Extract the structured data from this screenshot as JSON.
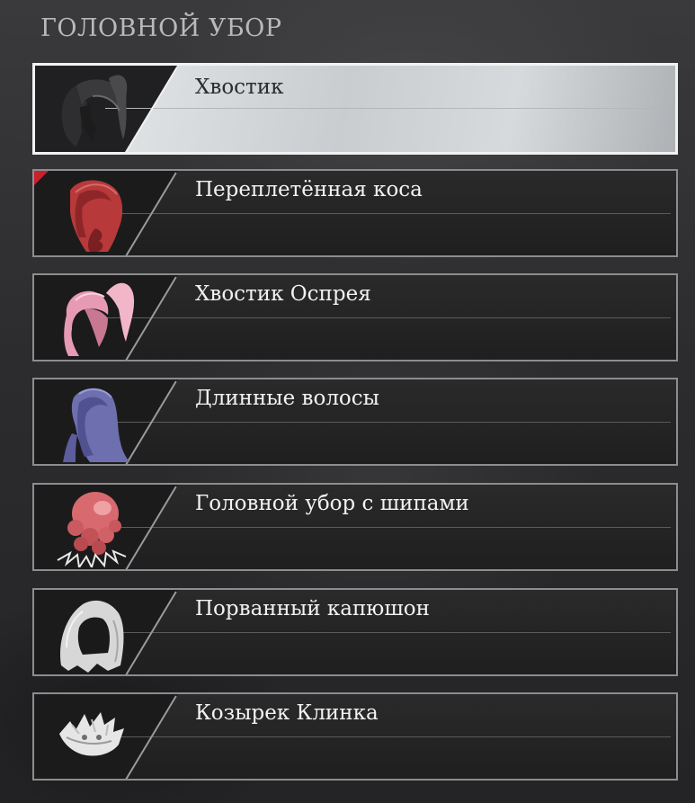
{
  "section_title": "ГОЛОВНОЙ УБОР",
  "items": [
    {
      "label": "Хвостик",
      "icon": "ponytail-hair-icon",
      "color": "#2e2e30",
      "selected": true,
      "new": false
    },
    {
      "label": "Переплетённая коса",
      "icon": "braided-hair-icon",
      "color": "#b8393a",
      "selected": false,
      "new": true
    },
    {
      "label": "Хвостик Оспрея",
      "icon": "pink-ponytail-hair-icon",
      "color": "#e79ab3",
      "selected": false,
      "new": false
    },
    {
      "label": "Длинные волосы",
      "icon": "long-hair-icon",
      "color": "#6d6fae",
      "selected": false,
      "new": false
    },
    {
      "label": "Головной убор с шипами",
      "icon": "spiked-headgear-icon",
      "color": "#d86a6f",
      "selected": false,
      "new": false
    },
    {
      "label": "Порванный капюшон",
      "icon": "torn-hood-icon",
      "color": "#d7d7d7",
      "selected": false,
      "new": false
    },
    {
      "label": "Козырек Клинка",
      "icon": "blade-visor-icon",
      "color": "#e6e6e6",
      "selected": false,
      "new": false
    }
  ]
}
